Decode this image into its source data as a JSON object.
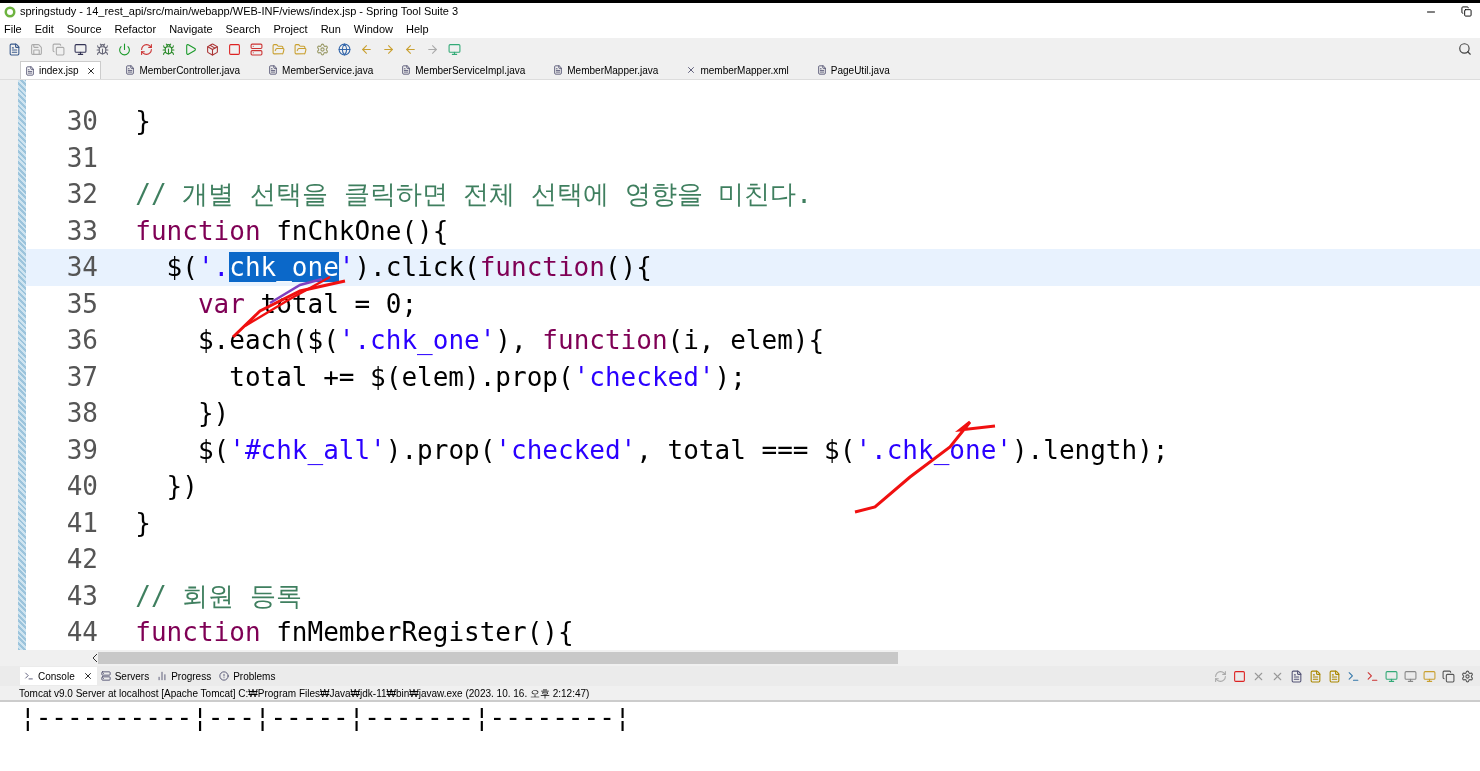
{
  "window": {
    "title": "springstudy - 14_rest_api/src/main/webapp/WEB-INF/views/index.jsp - Spring Tool Suite 3"
  },
  "menu": [
    "File",
    "Edit",
    "Source",
    "Refactor",
    "Navigate",
    "Search",
    "Project",
    "Run",
    "Window",
    "Help"
  ],
  "editor_tabs": [
    {
      "label": "index.jsp",
      "kind": "jsp",
      "selected": true
    },
    {
      "label": "MemberController.java",
      "kind": "java",
      "selected": false
    },
    {
      "label": "MemberService.java",
      "kind": "java",
      "selected": false
    },
    {
      "label": "MemberServiceImpl.java",
      "kind": "java",
      "selected": false
    },
    {
      "label": "MemberMapper.java",
      "kind": "java",
      "selected": false
    },
    {
      "label": "memberMapper.xml",
      "kind": "xml",
      "selected": false
    },
    {
      "label": "PageUtil.java",
      "kind": "java",
      "selected": false
    }
  ],
  "code_lines": [
    {
      "number": "30",
      "current": false,
      "tokens": [
        {
          "kind": "plain",
          "text": "  }"
        }
      ]
    },
    {
      "number": "31",
      "current": false
    },
    {
      "number": "32",
      "current": false,
      "tokens": [
        {
          "kind": "comment",
          "text": "  // 개별 선택을 클릭하면 전체 선택에 영향을 미친다."
        }
      ]
    },
    {
      "number": "33",
      "current": false,
      "tokens": [
        {
          "kind": "keyword",
          "text": "  function"
        },
        {
          "kind": "plain",
          "text": " fnChkOne(){"
        }
      ]
    },
    {
      "number": "34",
      "current": true,
      "tokens": [
        {
          "kind": "plain",
          "text": "    $("
        },
        {
          "kind": "string",
          "text": "'."
        },
        {
          "kind": "selected",
          "text": "chk_one"
        },
        {
          "kind": "string",
          "text": "'"
        },
        {
          "kind": "plain",
          "text": ").click("
        },
        {
          "kind": "keyword",
          "text": "function"
        },
        {
          "kind": "plain",
          "text": "(){"
        }
      ]
    },
    {
      "number": "35",
      "current": false,
      "tokens": [
        {
          "kind": "keyword",
          "text": "      var"
        },
        {
          "kind": "plain",
          "text": " total = 0;"
        }
      ]
    },
    {
      "number": "36",
      "current": false,
      "tokens": [
        {
          "kind": "plain",
          "text": "      $.each($("
        },
        {
          "kind": "string",
          "text": "'.chk_one'"
        },
        {
          "kind": "plain",
          "text": "), "
        },
        {
          "kind": "keyword",
          "text": "function"
        },
        {
          "kind": "plain",
          "text": "(i, elem){"
        }
      ]
    },
    {
      "number": "37",
      "current": false,
      "tokens": [
        {
          "kind": "plain",
          "text": "        total += $(elem).prop("
        },
        {
          "kind": "string",
          "text": "'checked'"
        },
        {
          "kind": "plain",
          "text": ");"
        }
      ]
    },
    {
      "number": "38",
      "current": false,
      "tokens": [
        {
          "kind": "plain",
          "text": "      })"
        }
      ]
    },
    {
      "number": "39",
      "current": false,
      "tokens": [
        {
          "kind": "plain",
          "text": "      $("
        },
        {
          "kind": "string",
          "text": "'#chk_all'"
        },
        {
          "kind": "plain",
          "text": ").prop("
        },
        {
          "kind": "string",
          "text": "'checked'"
        },
        {
          "kind": "plain",
          "text": ", total === $("
        },
        {
          "kind": "string",
          "text": "'.chk_one'"
        },
        {
          "kind": "plain",
          "text": ").length);"
        }
      ]
    },
    {
      "number": "40",
      "current": false,
      "tokens": [
        {
          "kind": "plain",
          "text": "    })"
        }
      ]
    },
    {
      "number": "41",
      "current": false,
      "tokens": [
        {
          "kind": "plain",
          "text": "  }"
        }
      ]
    },
    {
      "number": "42",
      "current": false
    },
    {
      "number": "43",
      "current": false,
      "tokens": [
        {
          "kind": "comment",
          "text": "  // 회원 등록"
        }
      ]
    },
    {
      "number": "44",
      "current": false,
      "tokens": [
        {
          "kind": "keyword",
          "text": "  function"
        },
        {
          "kind": "plain",
          "text": " fnMemberRegister(){"
        }
      ]
    }
  ],
  "console_tabs": [
    {
      "label": "Console",
      "selected": true
    },
    {
      "label": "Servers",
      "selected": false
    },
    {
      "label": "Progress",
      "selected": false
    },
    {
      "label": "Problems",
      "selected": false
    }
  ],
  "console_header": "Tomcat v9.0 Server at localhost [Apache Tomcat] C:₩Program Files₩Java₩jdk-11₩bin₩javaw.exe  (2023. 10. 16. 오후 2:12:47)",
  "console_output": [
    "¦----------¦---¦-----¦-------¦--------¦"
  ]
}
